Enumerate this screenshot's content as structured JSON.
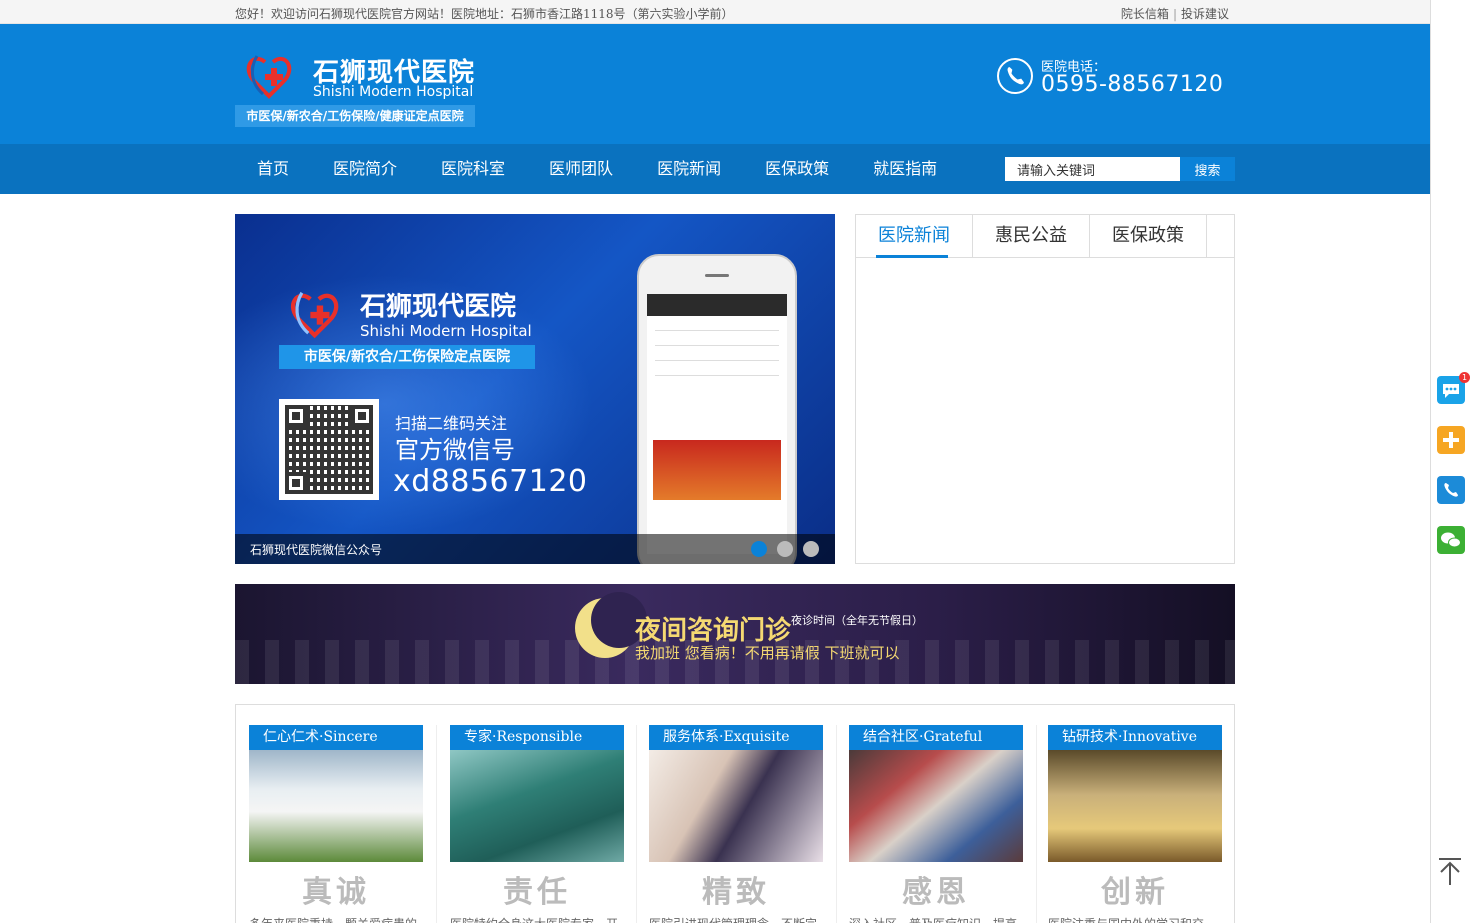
{
  "topbar": {
    "welcome": "您好！欢迎访问石狮现代医院官方网站！医院地址：石狮市香江路1118号（第六实验小学前）",
    "links": [
      "院长信箱",
      "投诉建议"
    ],
    "separator": "|"
  },
  "header": {
    "logo_cn": "石狮现代医院",
    "logo_en": "Shishi Modern Hospital",
    "logo_tag": "市医保/新农合/工伤保险/健康证定点医院",
    "phone_label": "医院电话：",
    "phone_number": "0595-88567120",
    "brand_color": "#0b82d8"
  },
  "nav": {
    "items": [
      "首页",
      "医院简介",
      "医院科室",
      "医师团队",
      "医院新闻",
      "医保政策",
      "就医指南"
    ],
    "search_placeholder": "请输入关键词",
    "search_button": "搜索"
  },
  "slider": {
    "logo_cn": "石狮现代医院",
    "logo_en": "Shishi Modern Hospital",
    "tag": "市医保/新农合/工伤保险定点医院",
    "scan_text": "扫描二维码关注",
    "wechat_text": "官方微信号",
    "wechat_id": "xd88567120",
    "caption": "石狮现代医院微信公众号",
    "slide_count": 3,
    "active_slide": 1
  },
  "news": {
    "tabs": [
      "医院新闻",
      "惠民公益",
      "医保政策"
    ],
    "active_tab": 0
  },
  "banner": {
    "title": "夜间咨询门诊",
    "time": "夜诊时间（全年无节假日）",
    "subtitle": "我加班 您看病！不用再请假 下班就可以"
  },
  "values": {
    "cards": [
      {
        "label": "仁心仁术·Sincere",
        "motto": "真诚",
        "desc": "多年来医院秉持一颗关爱病患的"
      },
      {
        "label": "专家·Responsible",
        "motto": "责任",
        "desc": "医院特约全身这大医院专家、开"
      },
      {
        "label": "服务体系·Exquisite",
        "motto": "精致",
        "desc": "医院引进现代管理理念，不断完"
      },
      {
        "label": "结合社区·Grateful",
        "motto": "感恩",
        "desc": "深入社区，普及医疗知识，提高"
      },
      {
        "label": "钻研技术·Innovative",
        "motto": "创新",
        "desc": "医院注重与国内外的学习和交"
      }
    ]
  },
  "rightbar": {
    "badge_count": "1",
    "icons": [
      "chat-icon",
      "share-plus-icon",
      "phone-icon",
      "wechat-icon",
      "back-to-top-icon"
    ],
    "colors": {
      "chat": "#1aa3e8",
      "plus": "#f6a623",
      "phone": "#1c8bd8",
      "wechat": "#3cb034"
    }
  }
}
